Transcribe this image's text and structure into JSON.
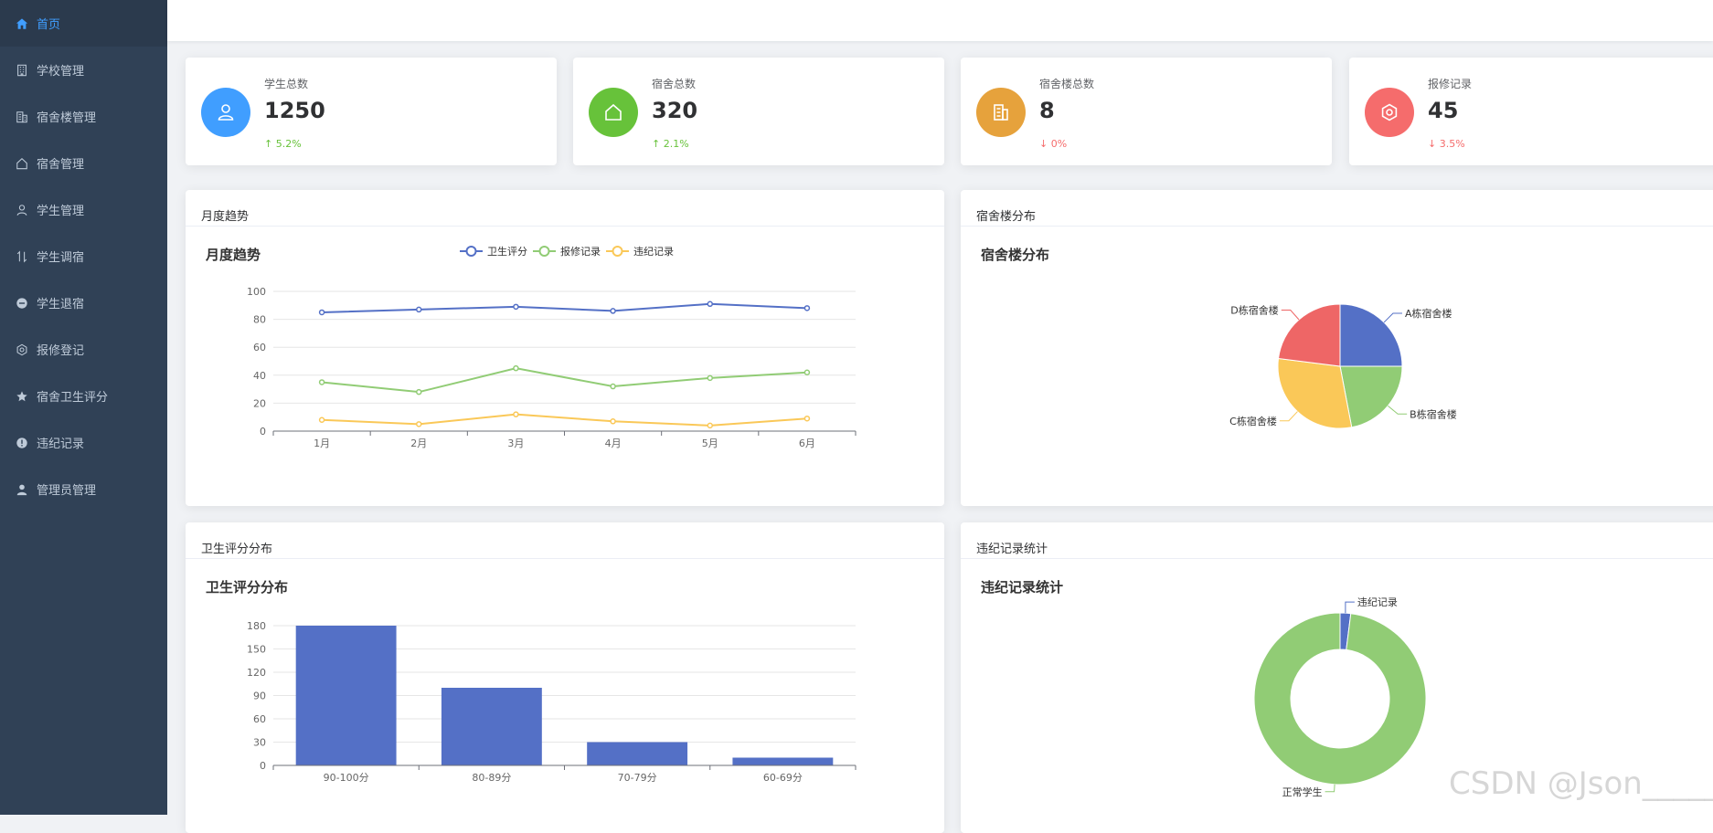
{
  "sidebar": {
    "items": [
      {
        "label": "首页",
        "icon": "home-icon",
        "active": true
      },
      {
        "label": "学校管理",
        "icon": "office-building-icon",
        "active": false
      },
      {
        "label": "宿舍楼管理",
        "icon": "building-icon",
        "active": false
      },
      {
        "label": "宿舍管理",
        "icon": "house-icon",
        "active": false
      },
      {
        "label": "学生管理",
        "icon": "user-icon",
        "active": false
      },
      {
        "label": "学生调宿",
        "icon": "swap-icon",
        "active": false
      },
      {
        "label": "学生退宿",
        "icon": "remove-circle-icon",
        "active": false
      },
      {
        "label": "报修登记",
        "icon": "gear-icon",
        "active": false
      },
      {
        "label": "宿舍卫生评分",
        "icon": "star-icon",
        "active": false
      },
      {
        "label": "违纪记录",
        "icon": "warning-icon",
        "active": false
      },
      {
        "label": "管理员管理",
        "icon": "admin-user-icon",
        "active": false
      }
    ]
  },
  "stats": [
    {
      "label": "学生总数",
      "value": "1250",
      "trend": "5.2%",
      "direction": "up",
      "color": "#409EFF",
      "icon": "user-icon"
    },
    {
      "label": "宿舍总数",
      "value": "320",
      "trend": "2.1%",
      "direction": "up",
      "color": "#67C23A",
      "icon": "house-icon"
    },
    {
      "label": "宿舍楼总数",
      "value": "8",
      "trend": "0%",
      "direction": "down",
      "color": "#E6A23C",
      "icon": "building-icon"
    },
    {
      "label": "报修记录",
      "value": "45",
      "trend": "3.5%",
      "direction": "down",
      "color": "#F56C6C",
      "icon": "gear-icon"
    }
  ],
  "panels": {
    "monthly": {
      "header": "月度趋势"
    },
    "building": {
      "header": "宿舍楼分布"
    },
    "hygiene": {
      "header": "卫生评分分布"
    },
    "violation": {
      "header": "违纪记录统计"
    }
  },
  "chart_data": [
    {
      "type": "line",
      "title": "月度趋势",
      "categories": [
        "1月",
        "2月",
        "3月",
        "4月",
        "5月",
        "6月"
      ],
      "ylim": [
        0,
        100
      ],
      "yticks": [
        0,
        20,
        40,
        60,
        80,
        100
      ],
      "grid": true,
      "legend": "top",
      "series": [
        {
          "name": "卫生评分",
          "values": [
            85,
            87,
            89,
            86,
            91,
            88
          ],
          "color": "#5470c6"
        },
        {
          "name": "报修记录",
          "values": [
            35,
            28,
            45,
            32,
            38,
            42
          ],
          "color": "#91cc75"
        },
        {
          "name": "违纪记录",
          "values": [
            8,
            5,
            12,
            7,
            4,
            9
          ],
          "color": "#fac858"
        }
      ]
    },
    {
      "type": "pie",
      "title": "宿舍楼分布",
      "slices": [
        {
          "name": "A栋宿舍楼",
          "value": 25,
          "color": "#5470c6"
        },
        {
          "name": "B栋宿舍楼",
          "value": 22,
          "color": "#91cc75"
        },
        {
          "name": "C栋宿舍楼",
          "value": 30,
          "color": "#fac858"
        },
        {
          "name": "D栋宿舍楼",
          "value": 23,
          "color": "#ee6666"
        }
      ]
    },
    {
      "type": "bar",
      "title": "卫生评分分布",
      "categories": [
        "90-100分",
        "80-89分",
        "70-79分",
        "60-69分"
      ],
      "values": [
        180,
        100,
        30,
        10
      ],
      "ylim": [
        0,
        180
      ],
      "yticks": [
        0,
        30,
        60,
        90,
        120,
        150,
        180
      ],
      "grid": true,
      "color": "#5470c6"
    },
    {
      "type": "pie",
      "title": "违纪记录统计",
      "donut": true,
      "slices": [
        {
          "name": "违纪记录",
          "value": 2,
          "color": "#5470c6"
        },
        {
          "name": "正常学生",
          "value": 98,
          "color": "#91cc75"
        }
      ]
    }
  ],
  "watermark": "CSDN @Json_____"
}
